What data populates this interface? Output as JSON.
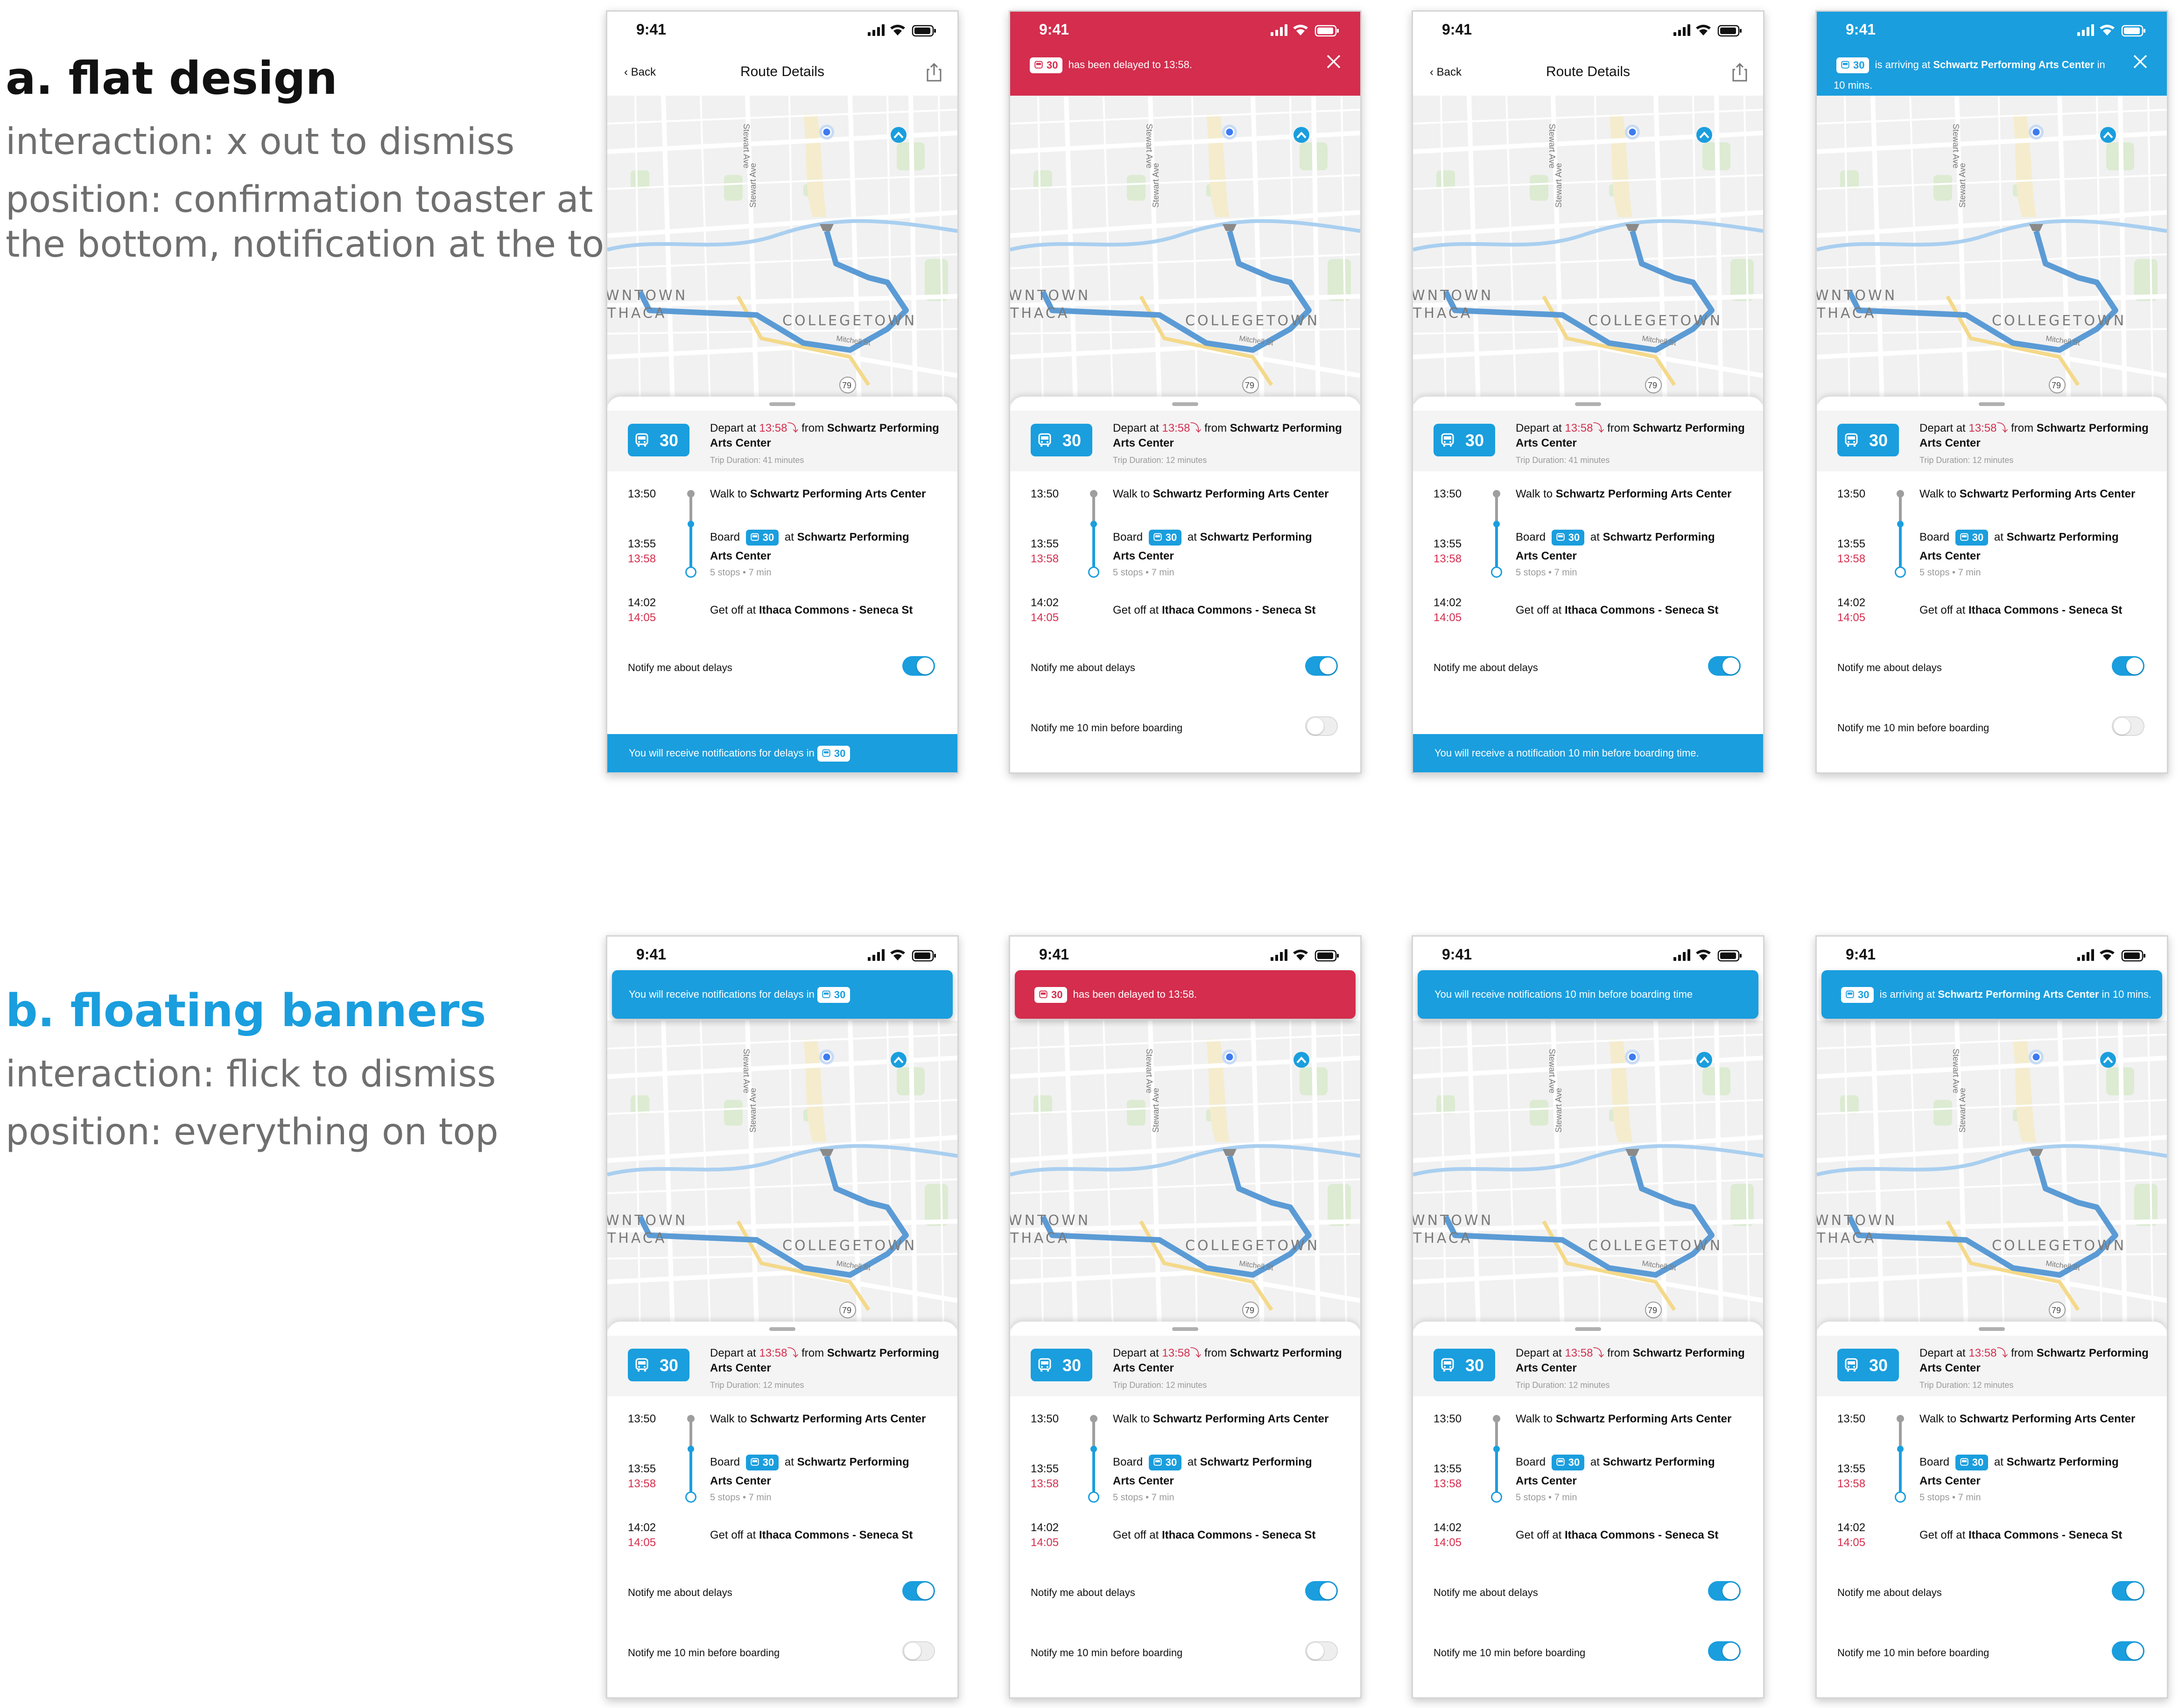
{
  "sections": [
    {
      "title": "a. flat design",
      "color": "#111111",
      "interaction": "interaction: x out to dismiss",
      "position_line1": "position: confirmation toaster at",
      "position_line2": "the bottom, notification at the top"
    },
    {
      "title": "b. floating banners",
      "color": "#1a9ede",
      "interaction": "interaction: flick to dismiss",
      "position_line1": "position: everything on top",
      "position_line2": ""
    }
  ],
  "colors": {
    "accent": "#1a9ede",
    "alert": "#d42d4d",
    "route": "#5b9bd5"
  },
  "common": {
    "time": "9:41",
    "header_back": "Back",
    "header_title": "Route Details",
    "bus_number": "30",
    "depart_prefix": "Depart at ",
    "depart_time": "13:58",
    "depart_from": " from ",
    "depart_place": "Schwartz Performing Arts Center",
    "duration_41": "Trip Duration: 41 minutes",
    "duration_12": "Trip Duration: 12 minutes",
    "step1_time": "13:50",
    "step1_text": "Walk to ",
    "step1_place": "Schwartz Performing Arts Center",
    "step2_time": "13:55",
    "step2_time_delayed": "13:58",
    "step2_board": "Board",
    "step2_at": " at ",
    "step2_place_a": "Schwartz Performing",
    "step2_place_b": "Arts Center",
    "step2_meta": "5 stops • 7 min",
    "step3_time": "14:02",
    "step3_time_delayed": "14:05",
    "step3_text": "Get off at ",
    "step3_place": "Ithaca Commons - Seneca St",
    "notify_delays": "Notify me about delays",
    "notify_10min": "Notify me 10 min before boarding",
    "map_downtown": "WNTOWN",
    "map_ithaca": "THACA",
    "map_collegetown": "COLLEGETOWN",
    "map_stewart": "Stewart Ave",
    "map_route79": "79",
    "map_street": "Mitchell St"
  },
  "messages": {
    "delays_prefix": "You will receive notifications for delays in",
    "delayed_suffix": "has been delayed to 13:58.",
    "ten_min_flat": "You will receive a notification 10 min before boarding time.",
    "ten_min_float": "You will receive notifications 10 min before boarding time",
    "arriving_mid": "is arriving at ",
    "arriving_place": "Schwartz Performing Arts Center",
    "arriving_flat_suffix": " in",
    "arriving_flat_line2": "10 mins.",
    "arriving_float_suffix": " in 10 mins."
  },
  "phones": [
    {
      "row": "a",
      "duration": "duration_41",
      "notify_delays_on": true,
      "notify_10min_on": false,
      "show_10min_row": false
    },
    {
      "row": "a",
      "duration": "duration_12",
      "notify_delays_on": true,
      "notify_10min_on": false,
      "show_10min_row": true
    },
    {
      "row": "a",
      "duration": "duration_41",
      "notify_delays_on": true,
      "notify_10min_on": false,
      "show_10min_row": false
    },
    {
      "row": "a",
      "duration": "duration_12",
      "notify_delays_on": true,
      "notify_10min_on": false,
      "show_10min_row": true
    },
    {
      "row": "b",
      "duration": "duration_12",
      "notify_delays_on": true,
      "notify_10min_on": false,
      "show_10min_row": true
    },
    {
      "row": "b",
      "duration": "duration_12",
      "notify_delays_on": true,
      "notify_10min_on": false,
      "show_10min_row": true
    },
    {
      "row": "b",
      "duration": "duration_12",
      "notify_delays_on": true,
      "notify_10min_on": true,
      "show_10min_row": true
    },
    {
      "row": "b",
      "duration": "duration_12",
      "notify_delays_on": true,
      "notify_10min_on": true,
      "show_10min_row": true
    }
  ]
}
